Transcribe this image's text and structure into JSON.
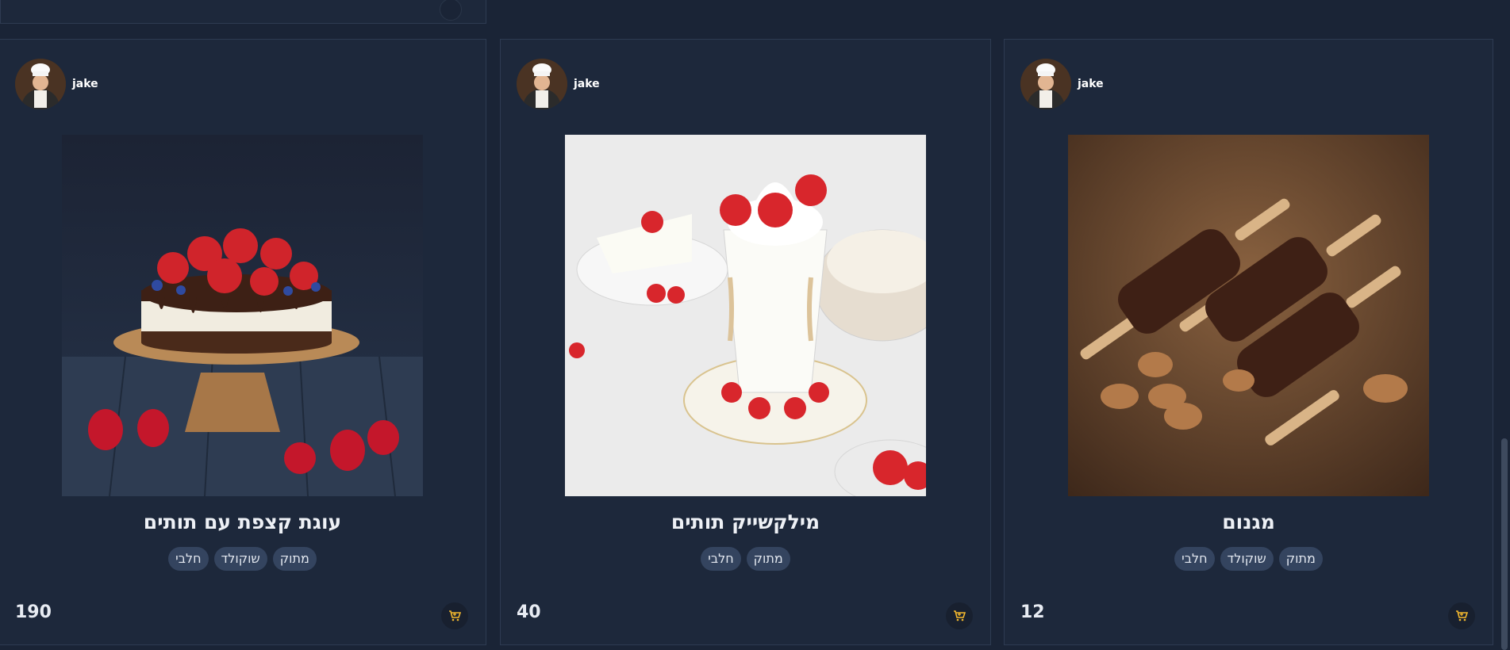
{
  "products": [
    {
      "author": "jake",
      "title": "עוגת קצפת עם תותים",
      "tags": [
        "מתוק",
        "שוקולד",
        "חלבי"
      ],
      "price": "190"
    },
    {
      "author": "jake",
      "title": "מילקשייק תותים",
      "tags": [
        "מתוק",
        "חלבי"
      ],
      "price": "40"
    },
    {
      "author": "jake",
      "title": "מגנום",
      "tags": [
        "מתוק",
        "שוקולד",
        "חלבי"
      ],
      "price": "12"
    }
  ],
  "icons": {
    "cart": "cart-icon",
    "avatar": "chef-avatar"
  },
  "colors": {
    "background": "#1a2436",
    "card": "#1d283b",
    "tag": "#34445f",
    "cart_accent": "#f5b92e"
  }
}
